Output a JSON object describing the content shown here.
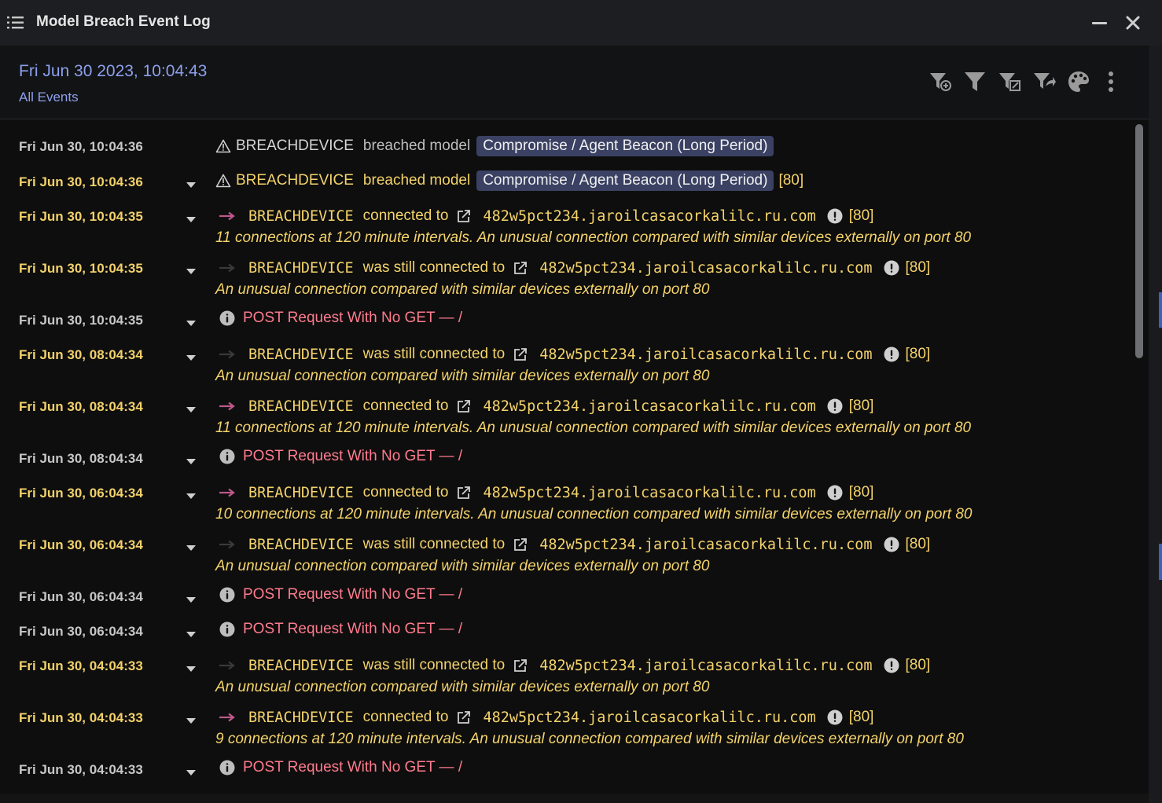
{
  "window": {
    "title": "Model Breach Event Log"
  },
  "header": {
    "date": "Fri Jun 30 2023, 10:04:43",
    "filter": "All Events"
  },
  "toolbar": [
    "filter-add-icon",
    "filter-icon",
    "filter-edit-icon",
    "filter-share-icon",
    "palette-icon",
    "more-vertical-icon"
  ],
  "device": "BREACHDEVICE",
  "model_name": "Compromise / Agent Beacon (Long Period)",
  "hostname": "482w5pct234.jaroilcasacorkalilc.ru.com",
  "port_tag": "[80]",
  "verbs": {
    "breached": "breached model",
    "connected": "connected to",
    "still_connected": "was still connected to"
  },
  "post_text": "POST Request With No GET —  /",
  "descriptions": {
    "unusual": "An unusual connection compared with similar devices externally on port 80",
    "c11": "11 connections at 120 minute intervals. An unusual connection compared with similar devices externally on port 80",
    "c10": "10 connections at 120 minute intervals. An unusual connection compared with similar devices externally on port 80",
    "c9": "9 connections at 120 minute intervals. An unusual connection compared with similar devices externally on port 80"
  },
  "events": [
    {
      "time": "Fri Jun 30, 10:04:36",
      "type": "breach",
      "highlight": false,
      "chevron": false,
      "port": false
    },
    {
      "time": "Fri Jun 30, 10:04:36",
      "type": "breach",
      "highlight": true,
      "chevron": true,
      "port": true
    },
    {
      "time": "Fri Jun 30, 10:04:35",
      "type": "connected",
      "desc": "c11"
    },
    {
      "time": "Fri Jun 30, 10:04:35",
      "type": "still",
      "desc": "unusual"
    },
    {
      "time": "Fri Jun 30, 10:04:35",
      "type": "post"
    },
    {
      "time": "Fri Jun 30, 08:04:34",
      "type": "still",
      "desc": "unusual"
    },
    {
      "time": "Fri Jun 30, 08:04:34",
      "type": "connected",
      "desc": "c11"
    },
    {
      "time": "Fri Jun 30, 08:04:34",
      "type": "post"
    },
    {
      "time": "Fri Jun 30, 06:04:34",
      "type": "connected",
      "desc": "c10"
    },
    {
      "time": "Fri Jun 30, 06:04:34",
      "type": "still",
      "desc": "unusual"
    },
    {
      "time": "Fri Jun 30, 06:04:34",
      "type": "post"
    },
    {
      "time": "Fri Jun 30, 06:04:34",
      "type": "post"
    },
    {
      "time": "Fri Jun 30, 04:04:33",
      "type": "still",
      "desc": "unusual"
    },
    {
      "time": "Fri Jun 30, 04:04:33",
      "type": "connected",
      "desc": "c9"
    },
    {
      "time": "Fri Jun 30, 04:04:33",
      "type": "post"
    },
    {
      "time": "Fri Jun 30, 04:04:33",
      "type": "post"
    }
  ]
}
